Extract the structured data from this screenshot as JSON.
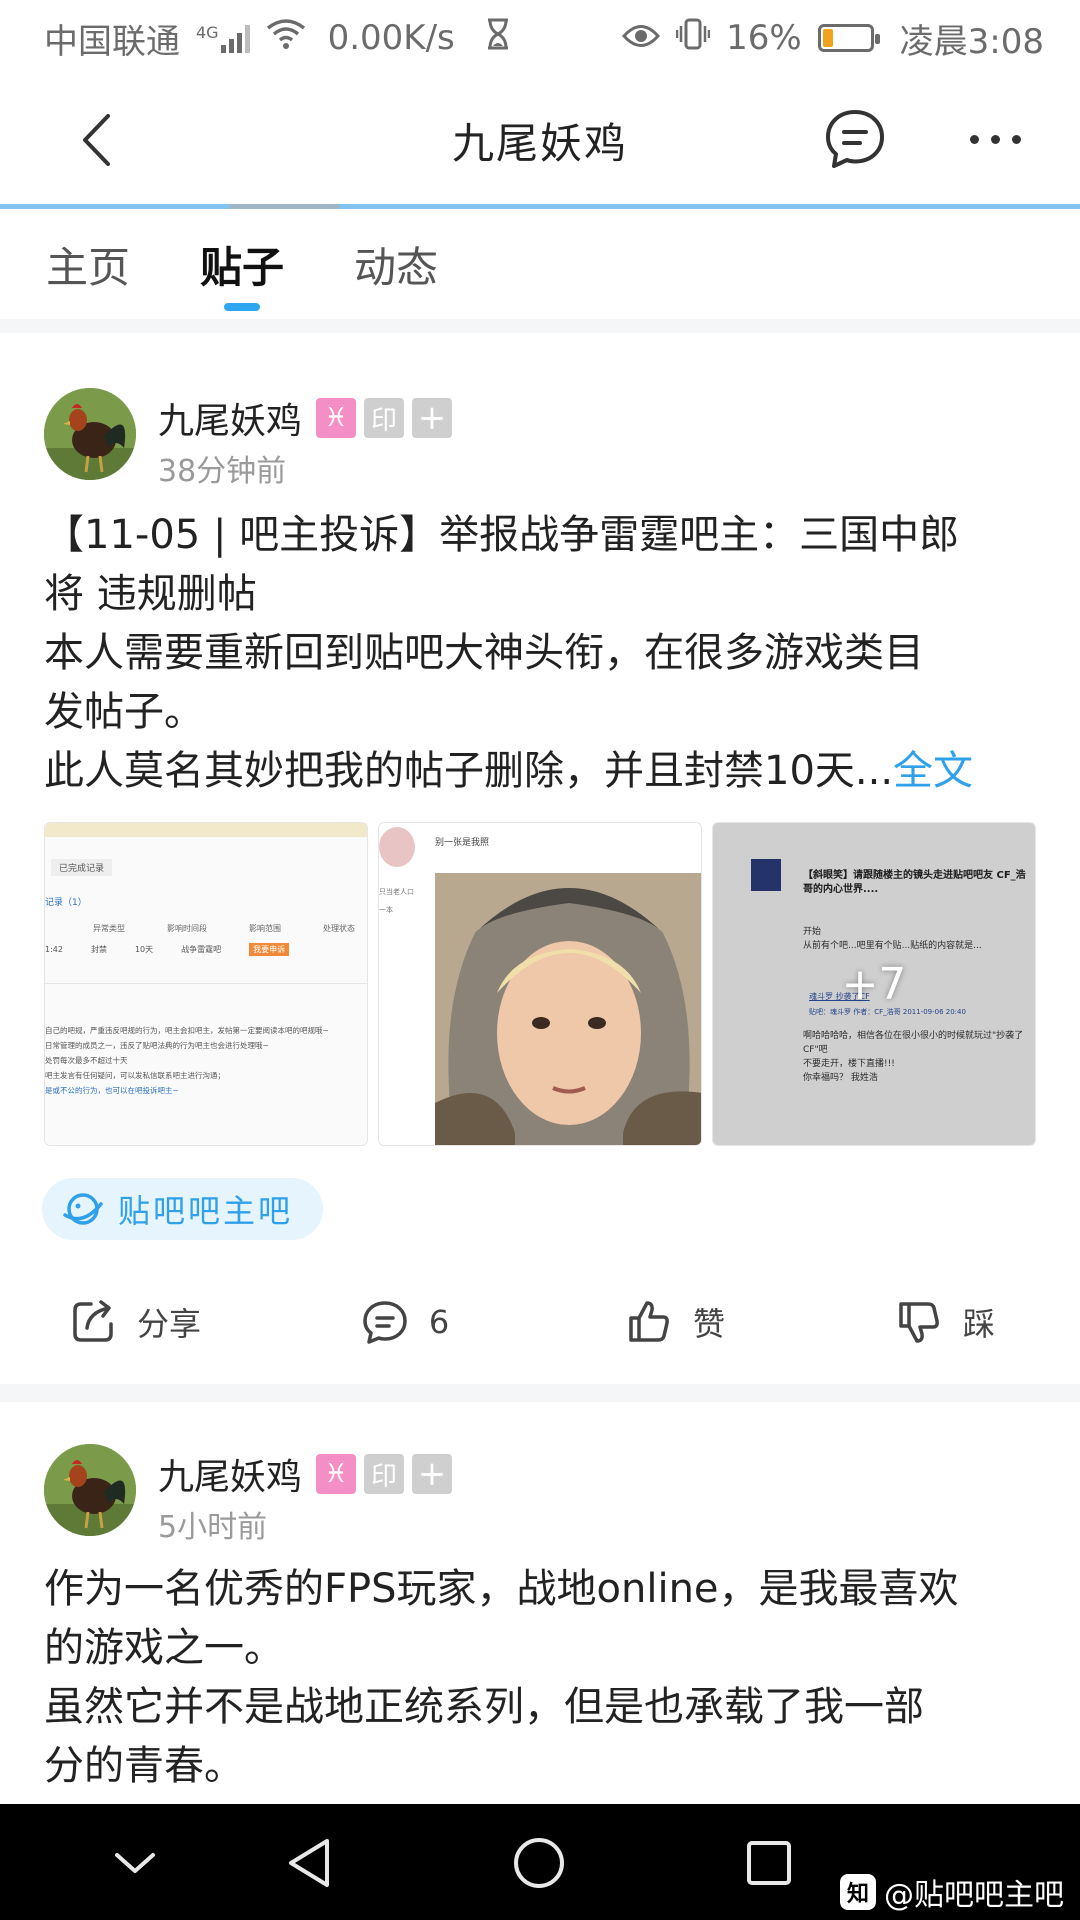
{
  "status_bar": {
    "carrier": "中国联通",
    "network": "4G",
    "speed": "0.00K/s",
    "battery": "16%",
    "battery_level": 0.16,
    "time": "凌晨3:08",
    "icons": [
      "signal-icon",
      "wifi-icon",
      "hourglass-icon",
      "eye-icon",
      "vibrate-icon",
      "battery-icon"
    ]
  },
  "header": {
    "title": "九尾妖鸡",
    "icons": [
      "back-icon",
      "message-icon",
      "more-icon"
    ]
  },
  "tabs": [
    {
      "label": "主页",
      "active": false
    },
    {
      "label": "贴子",
      "active": true
    },
    {
      "label": "动态",
      "active": false
    }
  ],
  "posts": [
    {
      "author": "九尾妖鸡",
      "badges": [
        "♓",
        "印",
        "+"
      ],
      "time": "38分钟前",
      "lines": [
        "【11-05 | 吧主投诉】举报战争雷霆吧主：三国中郎",
        "将 违规删帖",
        "本人需要重新回到贴吧大神头衔，在很多游戏类目",
        "发帖子。",
        "此人莫名其妙把我的帖子删除，并且封禁10天..."
      ],
      "fulltext_link": "全文",
      "images": [
        {
          "tab": "已完成记录",
          "records": "记录（1）",
          "headers": [
            "异常类型",
            "影响时间段",
            "影响范围",
            "处理状态"
          ],
          "row": [
            "1:42",
            "封禁",
            "10天",
            "战争雷霆吧",
            "我要申诉"
          ],
          "notes": [
            "自己的吧规，严重违反吧规的行为，吧主会扣吧主，发帖第一定要阅读本吧的吧规哦~",
            "日常管理的成员之一，违反了贴吧法典的行为吧主也会进行处理哦~",
            "处罚每次最多不超过十天",
            "吧主发言有任何疑问，可以发私信联系吧主进行沟通；",
            "是或不公的行为，也可以在吧投诉吧主~"
          ]
        },
        {
          "caption": "别一张是我照",
          "side_labels": [
            "只当老人口",
            "一本"
          ]
        },
        {
          "title": "【斜眼笑】请跟随楼主的镜头走进贴吧吧友 CF_浩哥的内心世界....",
          "body": [
            "开始",
            "从前有个吧...吧里有个贴...贴纸的内容就是..."
          ],
          "quote": "魂斗罗 抄袭了CF",
          "meta": "贴吧：魂斗罗 作者：CF_浩哥 2011-09-06 20:40",
          "reply": [
            "啊哈哈哈哈，相信各位在很小很小的时候就玩过\"抄袭了CF\"吧",
            "不要走开，楼下直播!!!",
            "你幸福吗？ 我姓浩"
          ],
          "more_count": "+7"
        }
      ],
      "forum_tag": "贴吧吧主吧",
      "actions": {
        "share": "分享",
        "comments": "6",
        "like": "赞",
        "dislike": "踩"
      }
    },
    {
      "author": "九尾妖鸡",
      "badges": [
        "♓",
        "印",
        "+"
      ],
      "time": "5小时前",
      "lines": [
        "作为一名优秀的FPS玩家，战地online，是我最喜欢",
        "的游戏之一。",
        "虽然它并不是战地正统系列，但是也承载了我一部",
        "分的青春。"
      ]
    }
  ],
  "nav_bar": {
    "icons": [
      "collapse-icon",
      "back-triangle-icon",
      "home-circle-icon",
      "recents-square-icon"
    ],
    "watermark": "@贴吧吧主吧",
    "watermark_logo": "知"
  }
}
